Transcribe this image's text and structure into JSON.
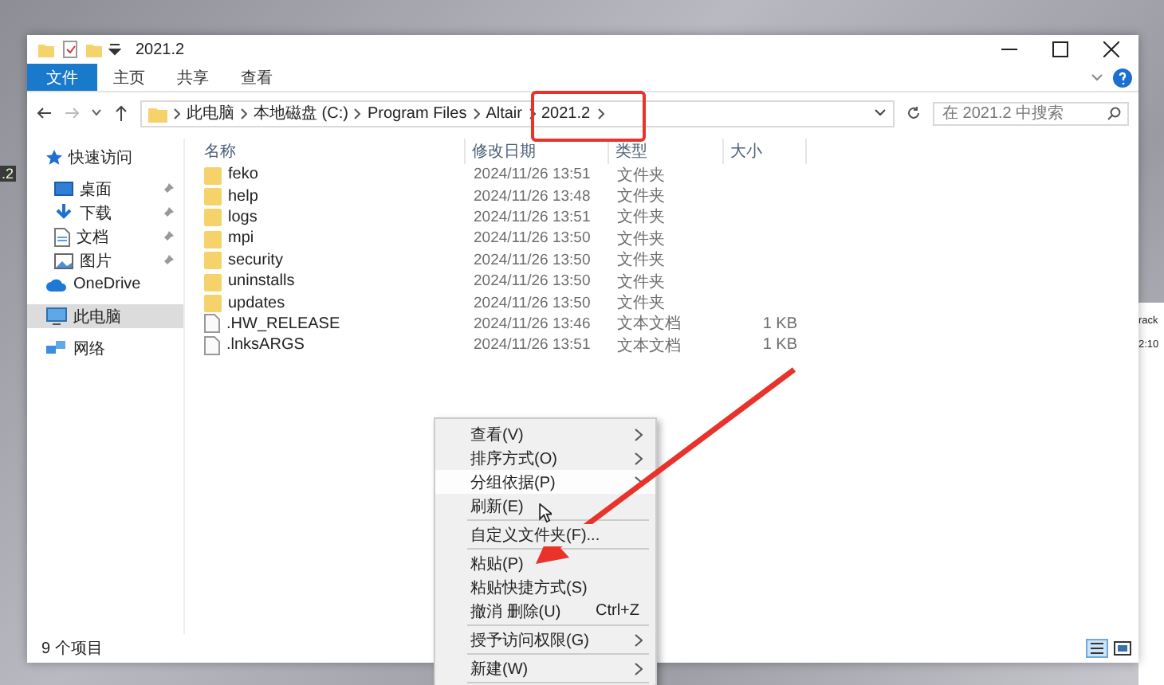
{
  "window": {
    "title": "2021.2"
  },
  "ribbon_tabs": [
    {
      "label": "文件",
      "selected": true
    },
    {
      "label": "主页",
      "selected": false
    },
    {
      "label": "共享",
      "selected": false
    },
    {
      "label": "查看",
      "selected": false
    }
  ],
  "breadcrumb": [
    "此电脑",
    "本地磁盘 (C:)",
    "Program Files",
    "Altair",
    "2021.2"
  ],
  "search": {
    "placeholder": "在 2021.2 中搜索"
  },
  "nav": [
    {
      "label": "快速访问",
      "selected": false,
      "children": [
        {
          "label": "桌面",
          "pinned": true,
          "selected": false
        },
        {
          "label": "下载",
          "pinned": true,
          "selected": false
        },
        {
          "label": "文档",
          "pinned": true,
          "selected": false
        },
        {
          "label": "图片",
          "pinned": true,
          "selected": false
        }
      ]
    },
    {
      "label": "OneDrive",
      "selected": false
    },
    {
      "label": "此电脑",
      "selected": true
    },
    {
      "label": "网络",
      "selected": false
    }
  ],
  "columns": [
    "名称",
    "修改日期",
    "类型",
    "大小"
  ],
  "files": [
    {
      "kind": "folder",
      "name": "feko",
      "date": "2024/11/26 13:51",
      "type": "文件夹"
    },
    {
      "kind": "folder",
      "name": "help",
      "date": "2024/11/26 13:48",
      "type": "文件夹"
    },
    {
      "kind": "folder",
      "name": "logs",
      "date": "2024/11/26 13:51",
      "type": "文件夹"
    },
    {
      "kind": "folder",
      "name": "mpi",
      "date": "2024/11/26 13:50",
      "type": "文件夹"
    },
    {
      "kind": "folder",
      "name": "security",
      "date": "2024/11/26 13:50",
      "type": "文件夹"
    },
    {
      "kind": "folder",
      "name": "uninstalls",
      "date": "2024/11/26 13:50",
      "type": "文件夹"
    },
    {
      "kind": "folder",
      "name": "updates",
      "date": "2024/11/26 13:50",
      "type": "文件夹"
    },
    {
      "kind": "file",
      "name": ".HW_RELEASE",
      "date": "2024/11/26 13:46",
      "type": "文本文档",
      "size": "1 KB"
    },
    {
      "kind": "file",
      "name": ".lnksARGS",
      "date": "2024/11/26 13:51",
      "type": "文本文档",
      "size": "1 KB"
    }
  ],
  "status_bar": "9 个项目",
  "context_menu": [
    {
      "kind": "item",
      "label": "查看(V)",
      "submenu": true,
      "highlighted": false
    },
    {
      "kind": "item",
      "label": "排序方式(O)",
      "submenu": true,
      "highlighted": false
    },
    {
      "kind": "item",
      "label": "分组依据(P)",
      "submenu": true,
      "highlighted": true
    },
    {
      "kind": "item",
      "label": "刷新(E)",
      "submenu": false,
      "highlighted": false
    },
    {
      "kind": "separator"
    },
    {
      "kind": "item",
      "label": "自定义文件夹(F)...",
      "submenu": false,
      "highlighted": false
    },
    {
      "kind": "separator"
    },
    {
      "kind": "item",
      "label": "粘贴(P)",
      "submenu": false,
      "highlighted": false
    },
    {
      "kind": "item",
      "label": "粘贴快捷方式(S)",
      "submenu": false,
      "highlighted": false
    },
    {
      "kind": "item",
      "label": "撤消 删除(U)",
      "shortcut": "Ctrl+Z",
      "submenu": false,
      "highlighted": false
    },
    {
      "kind": "separator"
    },
    {
      "kind": "item",
      "label": "授予访问权限(G)",
      "submenu": true,
      "highlighted": false
    },
    {
      "kind": "separator"
    },
    {
      "kind": "item",
      "label": "新建(W)",
      "submenu": true,
      "highlighted": false
    },
    {
      "kind": "separator"
    }
  ],
  "left_background_window": {
    "text": ".2"
  },
  "right_background_window": {
    "texts": [
      "rack",
      "2:10"
    ]
  }
}
